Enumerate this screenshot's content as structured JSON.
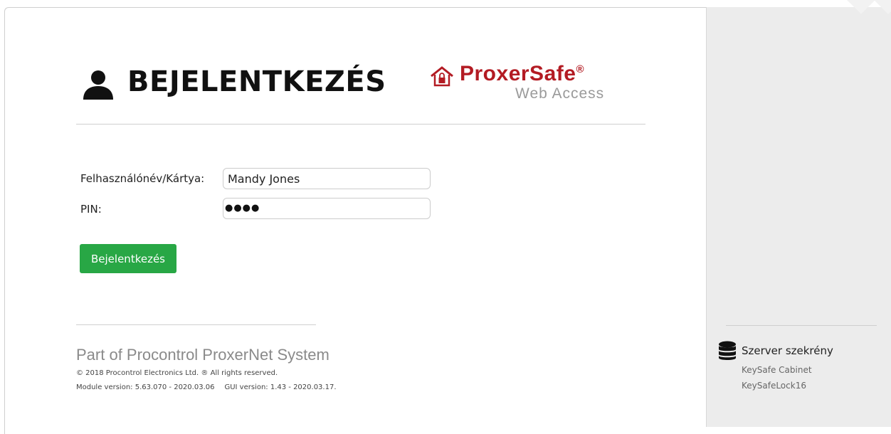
{
  "header": {
    "title": "BEJELENTKEZÉS",
    "brand_name": "ProxerSafe",
    "brand_reg": "®",
    "brand_sub": "Web Access"
  },
  "form": {
    "username_label": "Felhasználónév/Kártya:",
    "username_value": "Mandy Jones",
    "pin_label": "PIN:",
    "pin_mask": "●●●●",
    "login_label": "Bejelentkezés"
  },
  "footer": {
    "title": "Part of Procontrol ProxerNet System",
    "copyright": "© 2018 Procontrol Electronics Ltd. ® All rights reserved.",
    "module_version": "Module version: 5.63.070 - 2020.03.06",
    "gui_version": "GUI version: 1.43 - 2020.03.17."
  },
  "side": {
    "title": "Szerver szekrény",
    "line1": "KeySafe Cabinet",
    "line2": "KeySafeLock16"
  },
  "colors": {
    "brand_red": "#b31b23",
    "login_green": "#28a745",
    "side_bg": "#ececec"
  },
  "icons": {
    "user": "user-icon",
    "house_lock": "house-lock-icon",
    "database": "database-icon"
  }
}
